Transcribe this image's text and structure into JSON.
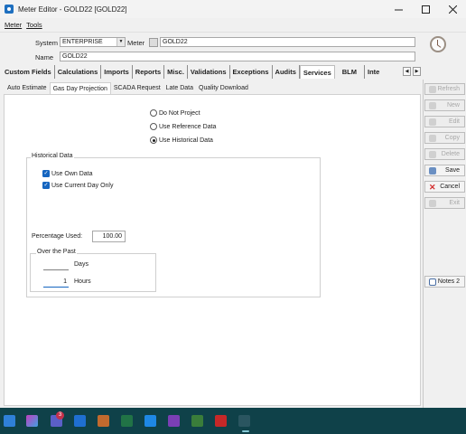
{
  "window": {
    "title": "Meter Editor - GOLD22 [GOLD22]",
    "min_icon": "minimize-icon",
    "max_icon": "maximize-icon",
    "close_icon": "close-icon"
  },
  "menu": {
    "items": [
      "Meter",
      "Tools"
    ]
  },
  "header": {
    "system_label": "System",
    "system_value": "ENTERPRISE",
    "meter_label": "Meter",
    "meter_value": "GOLD22",
    "name_label": "Name",
    "name_value": "GOLD22"
  },
  "main_tabs": [
    "Custom Fields",
    "Calculations",
    "Imports",
    "Reports",
    "Misc.",
    "Validations",
    "Exceptions",
    "Audits",
    "Services",
    "BLM",
    "Inte"
  ],
  "active_main_tab": "Services",
  "sub_tabs": [
    "Auto Estimate",
    "Gas Day Projection",
    "SCADA Request",
    "Late Data",
    "Quality Download"
  ],
  "active_sub_tab": "Gas Day Projection",
  "projection": {
    "options": [
      "Do Not Project",
      "Use Reference Data",
      "Use Historical Data"
    ],
    "selected": "Use Historical Data"
  },
  "historical": {
    "group_label": "Historical Data",
    "use_own_data": {
      "label": "Use Own Data",
      "checked": true
    },
    "use_current_day": {
      "label": "Use Current Day Only",
      "checked": true
    },
    "percentage_label": "Percentage Used:",
    "percentage_value": "100.00",
    "over_past_label": "Over the Past",
    "days_label": "Days",
    "days_value": "",
    "hours_label": "Hours",
    "hours_value": "1"
  },
  "sidebar": {
    "buttons": [
      {
        "label": "Refresh",
        "enabled": false
      },
      {
        "label": "New",
        "enabled": false
      },
      {
        "label": "Edit",
        "enabled": false
      },
      {
        "label": "Copy",
        "enabled": false
      },
      {
        "label": "Delete",
        "enabled": false
      },
      {
        "label": "Save",
        "enabled": true
      },
      {
        "label": "Cancel",
        "enabled": true
      },
      {
        "label": "Exit",
        "enabled": false
      }
    ],
    "notes_label": "Notes 2"
  },
  "taskbar": {
    "badge": "3"
  },
  "colors": {
    "accent": "#1565c0",
    "taskbar": "#0f4149",
    "cancel_icon": "#d32f2f"
  }
}
